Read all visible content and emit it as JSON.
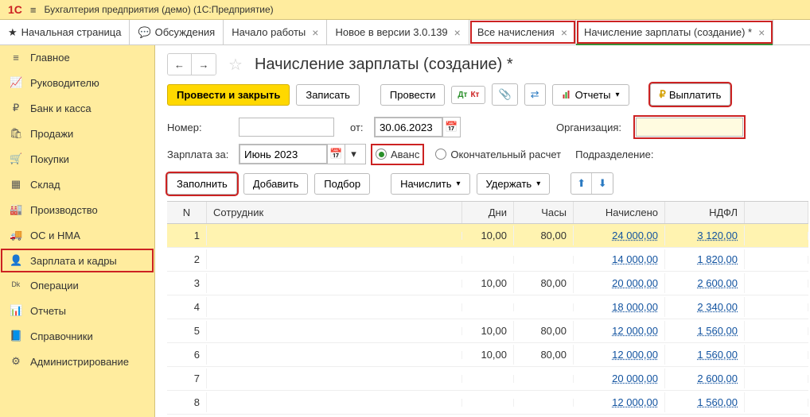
{
  "titlebar": {
    "app": "Бухгалтерия предприятия (демо)  (1С:Предприятие)"
  },
  "tabs": [
    {
      "icon": "★",
      "label": "Начальная страница",
      "close": false
    },
    {
      "icon": "💬",
      "label": "Обсуждения",
      "close": false
    },
    {
      "label": "Начало работы",
      "close": true
    },
    {
      "label": "Новое в версии 3.0.139",
      "close": true
    },
    {
      "label": "Все начисления",
      "close": true,
      "hl": true
    },
    {
      "label": "Начисление зарплаты (создание) *",
      "close": true,
      "hl": true,
      "active": true
    }
  ],
  "sidebar": [
    {
      "icon": "≡",
      "label": "Главное"
    },
    {
      "icon": "📈",
      "label": "Руководителю"
    },
    {
      "icon": "₽",
      "label": "Банк и касса"
    },
    {
      "icon": "🛍",
      "label": "Продажи"
    },
    {
      "icon": "🛒",
      "label": "Покупки"
    },
    {
      "icon": "▦",
      "label": "Склад"
    },
    {
      "icon": "🏭",
      "label": "Производство"
    },
    {
      "icon": "🚚",
      "label": "ОС и НМА"
    },
    {
      "icon": "👤",
      "label": "Зарплата и кадры",
      "hl": true
    },
    {
      "icon": "ᴰᵏ",
      "label": "Операции"
    },
    {
      "icon": "📊",
      "label": "Отчеты"
    },
    {
      "icon": "📘",
      "label": "Справочники"
    },
    {
      "icon": "⚙",
      "label": "Администрирование"
    }
  ],
  "page": {
    "title": "Начисление зарплаты (создание) *"
  },
  "toolbar": {
    "post_close": "Провести и закрыть",
    "save": "Записать",
    "post": "Провести",
    "reports": "Отчеты",
    "pay": "Выплатить"
  },
  "form": {
    "number_label": "Номер:",
    "number": "",
    "from_label": "от:",
    "date": "30.06.2023",
    "org_label": "Организация:",
    "salary_for_label": "Зарплата за:",
    "period": "Июнь 2023",
    "advance": "Аванс",
    "final": "Окончательный расчет",
    "department_label": "Подразделение:"
  },
  "actions": {
    "fill": "Заполнить",
    "add": "Добавить",
    "pick": "Подбор",
    "accrue": "Начислить",
    "withhold": "Удержать"
  },
  "grid": {
    "headers": {
      "n": "N",
      "emp": "Сотрудник",
      "days": "Дни",
      "hrs": "Часы",
      "acc": "Начислено",
      "tax": "НДФЛ"
    },
    "rows": [
      {
        "n": 1,
        "days": "10,00",
        "hrs": "80,00",
        "acc": "24 000,00",
        "tax": "3 120,00",
        "sel": true
      },
      {
        "n": 2,
        "days": "",
        "hrs": "",
        "acc": "14 000,00",
        "tax": "1 820,00"
      },
      {
        "n": 3,
        "days": "10,00",
        "hrs": "80,00",
        "acc": "20 000,00",
        "tax": "2 600,00"
      },
      {
        "n": 4,
        "days": "",
        "hrs": "",
        "acc": "18 000,00",
        "tax": "2 340,00"
      },
      {
        "n": 5,
        "days": "10,00",
        "hrs": "80,00",
        "acc": "12 000,00",
        "tax": "1 560,00"
      },
      {
        "n": 6,
        "days": "10,00",
        "hrs": "80,00",
        "acc": "12 000,00",
        "tax": "1 560,00"
      },
      {
        "n": 7,
        "days": "",
        "hrs": "",
        "acc": "20 000,00",
        "tax": "2 600,00"
      },
      {
        "n": 8,
        "days": "",
        "hrs": "",
        "acc": "12 000,00",
        "tax": "1 560,00"
      }
    ]
  }
}
